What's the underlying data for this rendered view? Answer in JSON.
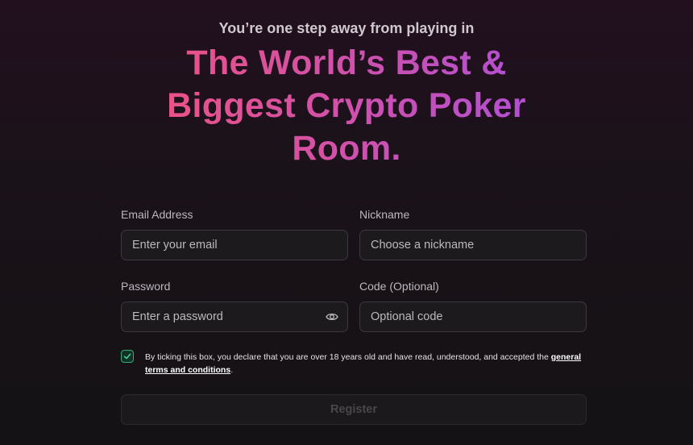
{
  "hero": {
    "subtitle": "You’re one step away from playing in",
    "headline_line1": "The World’s Best &",
    "headline_line2": "Biggest Crypto Poker",
    "headline_line3": "Room."
  },
  "form": {
    "email": {
      "label": "Email Address",
      "placeholder": "Enter your email"
    },
    "nickname": {
      "label": "Nickname",
      "placeholder": "Choose a nickname"
    },
    "password": {
      "label": "Password",
      "placeholder": "Enter a password"
    },
    "code": {
      "label": "Code (Optional)",
      "placeholder": "Optional code"
    },
    "consent": {
      "checked": true,
      "text": "By ticking this box, you declare that you are over 18 years old and have read, understood, and accepted the ",
      "link": "general terms and conditions",
      "suffix": "."
    },
    "register_label": "Register"
  },
  "colors": {
    "gradient_start": "#f2537a",
    "gradient_end": "#a84fe0",
    "checkbox_accent": "#2fae7a"
  },
  "icons": {
    "password_toggle": "eye-icon",
    "consent_check": "checkmark-icon"
  }
}
